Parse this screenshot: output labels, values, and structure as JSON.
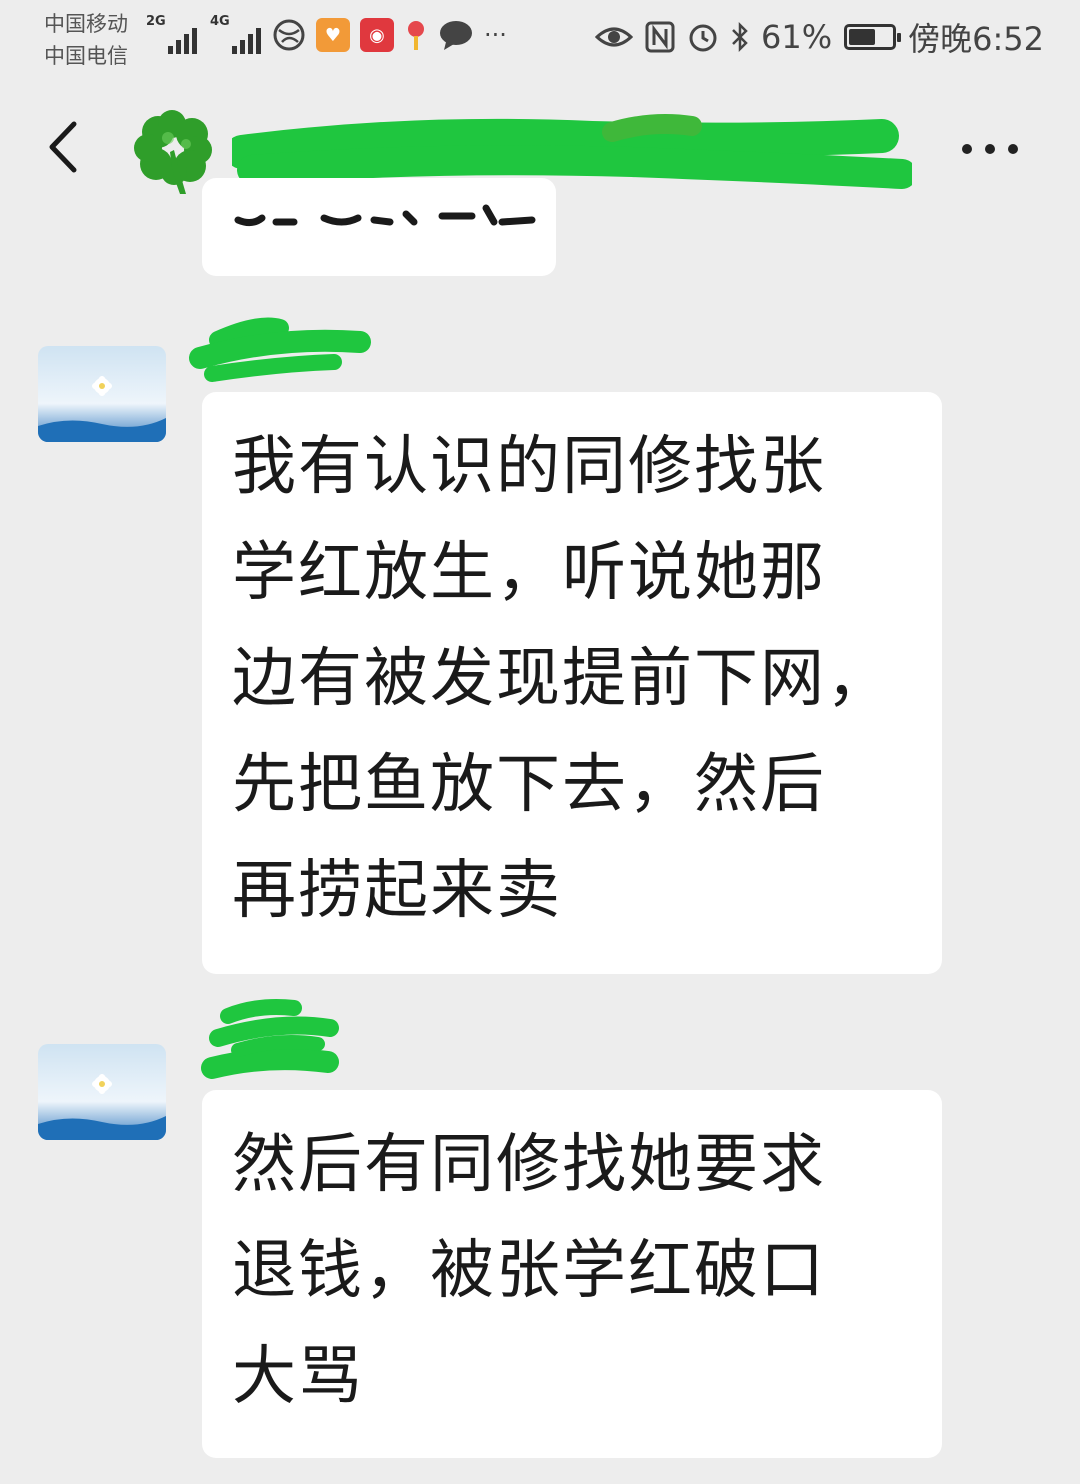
{
  "status_bar": {
    "carrier_1": "中国移动",
    "carrier_2": "中国电信",
    "network_1": "2G",
    "network_2": "4G",
    "battery_percent": "61%",
    "battery_level": 0.61,
    "time": "傍晚6:52"
  },
  "nav": {
    "back_icon": "chevron-left-icon",
    "group_icon": "four-leaf-clover-icon",
    "title": "",
    "more_icon": "more-dots-icon"
  },
  "messages": [
    {
      "sender": "",
      "text": "",
      "partial": true
    },
    {
      "sender": "",
      "text": "我有认识的同修找张\n学红放生，听说她那\n边有被发现提前下网，\n先把鱼放下去，然后\n再捞起来卖"
    },
    {
      "sender": "",
      "text": "然后有同修找她要求\n退钱，被张学红破口\n大骂"
    }
  ],
  "colors": {
    "background": "#ededed",
    "bubble": "#ffffff",
    "redaction_green": "#1fc63f",
    "clover_green": "#2f9e2a"
  }
}
